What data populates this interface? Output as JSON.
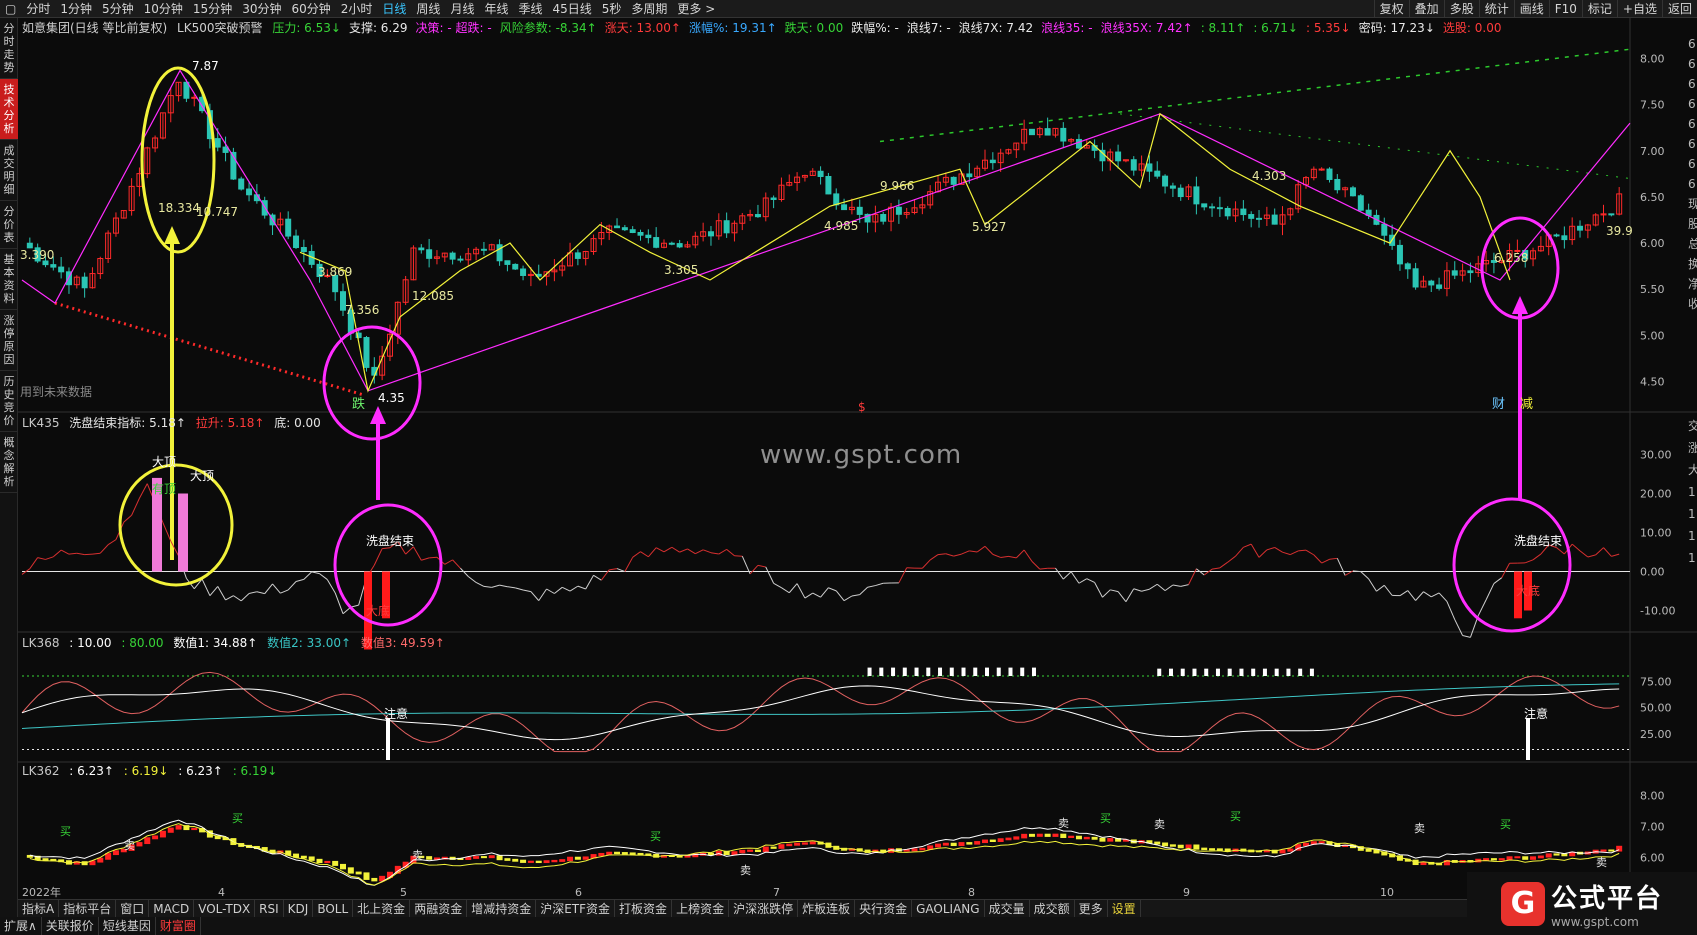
{
  "toolbar": {
    "periods": [
      "分时",
      "1分钟",
      "5分钟",
      "10分钟",
      "15分钟",
      "30分钟",
      "60分钟",
      "2小时",
      "日线",
      "周线",
      "月线",
      "年线",
      "季线",
      "45日线",
      "5秒",
      "多周期",
      "更多 >"
    ],
    "active_period": "日线",
    "right_tools": [
      "复权",
      "叠加",
      "多股",
      "统计",
      "画线",
      "F10",
      "标记",
      "+自选",
      "返回"
    ]
  },
  "sidebar": {
    "items": [
      "分时走势",
      "技术分析",
      "成交明细",
      "分价表",
      "基本资料",
      "涨停原因",
      "历史竞价",
      "概念解析"
    ],
    "active": "技术分析"
  },
  "main": {
    "title": "如意集团(日线 等比前复权)",
    "indicator_name": "LK500突破预警",
    "fields": [
      {
        "label": "压力: 6.53↓",
        "color": "#37d437"
      },
      {
        "label": "支撑: 6.29",
        "color": "#e9e9e9"
      },
      {
        "label": "决策: - 超跌: -",
        "color": "#ff33ff"
      },
      {
        "label": "风险参数: -8.34↑",
        "color": "#37d437"
      },
      {
        "label": "涨天: 13.00↑",
        "color": "#ff3b3b"
      },
      {
        "label": "涨幅%: 19.31↑",
        "color": "#39a9ff"
      },
      {
        "label": "跌天: 0.00",
        "color": "#37d437"
      },
      {
        "label": "跌幅%: -",
        "color": "#e9e9e9"
      },
      {
        "label": "浪线7: -",
        "color": "#e9e9e9"
      },
      {
        "label": "浪线7X: 7.42",
        "color": "#e9e9e9"
      },
      {
        "label": "浪线35: -",
        "color": "#ff33ff"
      },
      {
        "label": "浪线35X: 7.42↑",
        "color": "#ff33ff"
      },
      {
        "label": ": 8.11↑",
        "color": "#37d437"
      },
      {
        "label": ": 6.71↓",
        "color": "#37d437"
      },
      {
        "label": ": 5.35↓",
        "color": "#ff3b3b"
      },
      {
        "label": "密码: 17.23↓",
        "color": "#e9e9e9"
      },
      {
        "label": "选股: 0.00",
        "color": "#ff3b3b"
      }
    ],
    "y_ticks": [
      "8.00",
      "7.50",
      "7.00",
      "6.50",
      "6.00",
      "5.50",
      "5.00",
      "4.50"
    ],
    "annotations": {
      "high": "7.87",
      "p1": "3.390",
      "p2": "18.334",
      "p3": "10.747",
      "p4": "3.869",
      "p5": "7.356",
      "low": "4.35",
      "p6": "12.085",
      "p7": "3.305",
      "p8": "9.966",
      "p9": "4.985",
      "p10": "5.927",
      "p11": "4.303",
      "p12": "6.258",
      "p13": "39.9",
      "future": "用到未来数据",
      "die": "跌",
      "cai": "财",
      "jian": "减",
      "dollar": "$"
    },
    "right_edge": [
      "6",
      "6",
      "6",
      "6",
      "6",
      "6",
      "6",
      "6",
      "现",
      "股",
      "总",
      "换",
      "净",
      "收"
    ]
  },
  "pane2": {
    "name": "LK435",
    "indicator": "洗盘结束指标: 5.18↑",
    "rise": "拉升: 5.18↑",
    "bottom": "底: 0.00",
    "y_ticks": [
      "30.00",
      "20.00",
      "10.00",
      "0.00",
      "-10.00"
    ],
    "labels": {
      "top1": "大顶",
      "top2": "大顶",
      "top3": "有顶",
      "end1": "洗盘结束",
      "end2": "洗盘结束",
      "bottom1": "大底",
      "bottom2": "大底"
    },
    "right_edge": [
      "交",
      "涨",
      "大",
      "1",
      "1",
      "1",
      "1"
    ]
  },
  "pane3": {
    "name": "LK368",
    "v0": ": 10.00",
    "v1": ": 80.00",
    "n1": "数值1: 34.88↑",
    "n2": "数值2: 33.00↑",
    "n3": "数值3: 49.59↑",
    "y_ticks": [
      "75.00",
      "50.00",
      "25.00"
    ],
    "note1": "注意",
    "note2": "注意"
  },
  "pane4": {
    "name": "LK362",
    "a": ": 6.23↑",
    "b": ": 6.19↓",
    "c": ": 6.23↑",
    "d": ": 6.19↓",
    "y_ticks": [
      "8.00",
      "7.00",
      "6.00",
      "5.00"
    ],
    "buy": "买",
    "sell": "卖"
  },
  "x_axis": [
    "2022年",
    "4",
    "5",
    "6",
    "7",
    "8",
    "9",
    "10"
  ],
  "bottom_tabs": [
    "指标A",
    "指标平台",
    "窗口",
    "MACD",
    "VOL-TDX",
    "RSI",
    "KDJ",
    "BOLL",
    "北上资金",
    "两融资金",
    "增减持资金",
    "沪深ETF资金",
    "打板资金",
    "上榜资金",
    "沪深涨跌停",
    "炸板连板",
    "央行资金",
    "GAOLIANG",
    "成交量",
    "成交额",
    "更多",
    "设置"
  ],
  "selected_bottom_tab": "设置",
  "bottom_tabs2": [
    "扩展∧",
    "关联报价",
    "短线基因",
    "财富圈"
  ],
  "watermark": "www.gspt.com",
  "logo": {
    "cn": "公式平台",
    "en": "www.gspt.com",
    "mark": "G"
  },
  "colors": {
    "up": "#ff2a2a",
    "down": "#2bc5b4",
    "yellow": "#f2f23a",
    "magenta": "#ff2cff",
    "green_dot": "#2cc92c"
  },
  "chart_data": {
    "type": "line",
    "title": "如意集团(日线 等比前复权)",
    "ylim": [
      4.3,
      8.2
    ],
    "x": [
      "2022年",
      "4",
      "5",
      "6",
      "7",
      "8",
      "9",
      "10"
    ],
    "series": [
      {
        "name": "浪线7X",
        "values": [
          5.3,
          7.87,
          5.9,
          4.35,
          5.2,
          5.9,
          6.3,
          7.4,
          6.3,
          5.6,
          6.5
        ]
      }
    ]
  }
}
